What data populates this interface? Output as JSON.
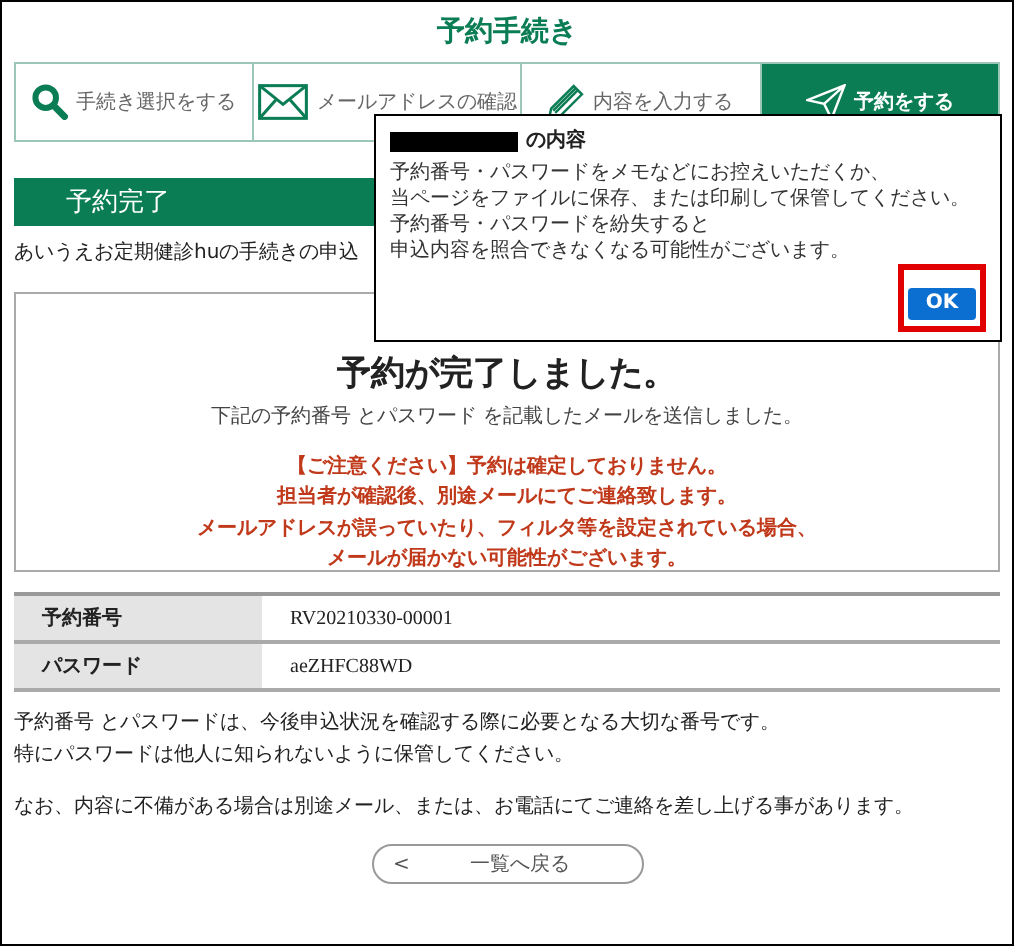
{
  "page_title": "予約手続き",
  "steps": [
    {
      "kind": "search",
      "label": "手続き選択をする",
      "selected": false
    },
    {
      "kind": "mail",
      "label": "メールアドレスの確認",
      "selected": false
    },
    {
      "kind": "pencil",
      "label": "内容を入力する",
      "selected": false
    },
    {
      "kind": "send",
      "label": "予約をする",
      "selected": true
    }
  ],
  "section_heading": "予約完了",
  "intro": "あいうえお定期健診huの手続きの申込",
  "result": {
    "title": "予約が完了しました。",
    "subtitle": "下記の予約番号 とパスワード を記載したメールを送信しました。",
    "warning": [
      "【ご注意ください】予約は確定しておりません。",
      "担当者が確認後、別途メールにてご連絡致します。",
      "メールアドレスが誤っていたり、フィルタ等を設定されている場合、",
      "メールが届かない可能性がございます。"
    ]
  },
  "details": [
    {
      "label": "予約番号",
      "value": "RV20210330-00001"
    },
    {
      "label": "パスワード",
      "value": "aeZHFC88WD"
    }
  ],
  "notes": [
    "予約番号 とパスワードは、今後申込状況を確認する際に必要となる大切な番号です。",
    "特にパスワードは他人に知られないように保管してください。"
  ],
  "notice": "なお、内容に不備がある場合は別途メール、または、お電話にてご連絡を差し上げる事があります。",
  "back_button": {
    "arrow": "<",
    "label": "一覧へ戻る"
  },
  "dialog": {
    "title": "の内容",
    "redacted": true,
    "message": [
      "予約番号・パスワードをメモなどにお控えいただくか、",
      "当ページをファイルに保存、または印刷して保管してください。",
      "予約番号・パスワードを紛失すると",
      "申込内容を照合できなくなる可能性がございます。"
    ],
    "ok_label": "OK",
    "ok_highlighted": true
  }
}
